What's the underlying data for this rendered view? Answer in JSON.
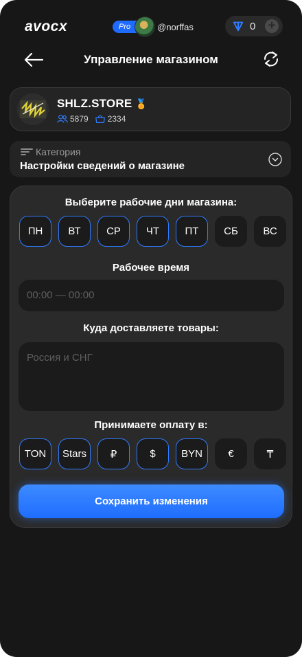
{
  "topbar": {
    "logo": "avocx",
    "pro_badge": "Pro",
    "username": "@norffas",
    "balance": "0"
  },
  "header": {
    "title": "Управление магазином"
  },
  "store": {
    "name": "SHLZ.STORE",
    "medal": "🏅",
    "followers": "5879",
    "orders": "2334"
  },
  "category": {
    "label": "Категория",
    "value": "Настройки сведений о магазине"
  },
  "settings": {
    "days_title": "Выберите рабочие дни магазина:",
    "days": [
      {
        "label": "ПН",
        "selected": true
      },
      {
        "label": "ВТ",
        "selected": true
      },
      {
        "label": "СР",
        "selected": true
      },
      {
        "label": "ЧТ",
        "selected": true
      },
      {
        "label": "ПТ",
        "selected": true
      },
      {
        "label": "СБ",
        "selected": false
      },
      {
        "label": "ВС",
        "selected": false
      }
    ],
    "hours_title": "Рабочее время",
    "hours_placeholder": "00:00 — 00:00",
    "delivery_title": "Куда доставляете товары:",
    "delivery_placeholder": "Россия и СНГ",
    "payment_title": "Принимаете оплату в:",
    "payments": [
      {
        "label": "TON",
        "selected": true
      },
      {
        "label": "Stars",
        "selected": true
      },
      {
        "label": "₽",
        "selected": true
      },
      {
        "label": "$",
        "selected": true
      },
      {
        "label": "BYN",
        "selected": true
      },
      {
        "label": "€",
        "selected": false
      },
      {
        "label": "₸",
        "selected": false
      }
    ],
    "save_label": "Сохранить изменения"
  },
  "colors": {
    "accent": "#2f7bff",
    "background": "#171717",
    "card": "#242424"
  }
}
